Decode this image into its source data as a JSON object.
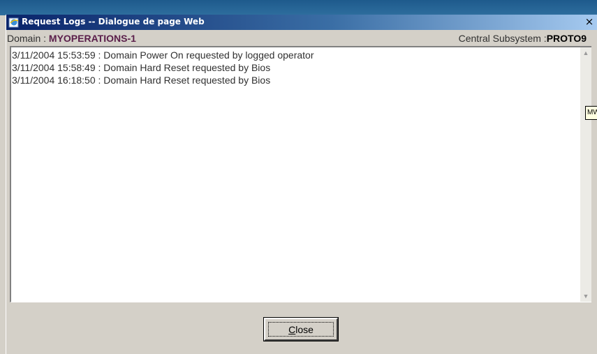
{
  "window": {
    "title": "Request Logs -- Dialogue de page Web",
    "close_glyph": "×"
  },
  "header": {
    "domain_label": "Domain : ",
    "domain_value": "MYOPERATIONS-1",
    "subsystem_label": "Central Subsystem :",
    "subsystem_value": "PROTO9"
  },
  "logs": [
    "3/11/2004 15:53:59 : Domain Power On requested by logged operator",
    "3/11/2004 15:58:49 : Domain Hard Reset requested by Bios",
    "3/11/2004 16:18:50 : Domain Hard Reset requested by Bios"
  ],
  "tooltip": {
    "text": "MW"
  },
  "buttons": {
    "close_accel": "C",
    "close_rest": "lose"
  },
  "icons": {
    "title": "ie-page-icon",
    "scroll_up": "arrow-up-icon",
    "scroll_down": "arrow-down-icon"
  }
}
